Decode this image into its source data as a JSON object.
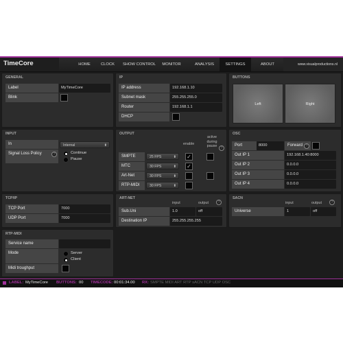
{
  "app": {
    "title": "TimeCore",
    "website": "www.visualproductions.nl",
    "accent_color": "#a0309a"
  },
  "nav": [
    {
      "label": "HOME",
      "active": false
    },
    {
      "label": "CLOCK",
      "active": false
    },
    {
      "label": "SHOW CONTROL",
      "active": false
    },
    {
      "label": "MONITOR",
      "active": false
    },
    {
      "label": "ANALYSIS",
      "active": false
    },
    {
      "label": "SETTINGS",
      "active": true
    },
    {
      "label": "ABOUT",
      "active": false
    }
  ],
  "general": {
    "title": "GENERAL",
    "label_label": "Label",
    "label_value": "MyTimeCore",
    "blink_label": "Blink",
    "blink_checked": false
  },
  "ip": {
    "title": "IP",
    "ip_label": "IP address",
    "ip_value": "192.168.1.10",
    "subnet_label": "Subnet mask",
    "subnet_value": "255.255.255.0",
    "router_label": "Router",
    "router_value": "192.168.1.1",
    "dhcp_label": "DHCP",
    "dhcp_checked": false
  },
  "buttons": {
    "title": "BUTTONS",
    "left": "Left",
    "right": "Right"
  },
  "input": {
    "title": "INPUT",
    "in_label": "In",
    "in_value": "Internal",
    "policy_label": "Signal Loss Policy",
    "help": "?",
    "options": [
      {
        "label": "Continue",
        "selected": true
      },
      {
        "label": "Pause",
        "selected": false
      }
    ]
  },
  "output": {
    "title": "OUTPUT",
    "enable_header": "enable",
    "active_header_1": "active",
    "active_header_2": "during",
    "active_header_3": "pause",
    "help": "?",
    "rows": [
      {
        "label": "SMPTE",
        "fps": "25 FPS",
        "enabled": true,
        "active_pause": false,
        "has_pause": true
      },
      {
        "label": "MTC",
        "fps": "30 FPS",
        "enabled": true,
        "active_pause": false,
        "has_pause": false
      },
      {
        "label": "Art-Net",
        "fps": "30 FPS",
        "enabled": false,
        "active_pause": false,
        "has_pause": true
      },
      {
        "label": "RTP-MIDI",
        "fps": "30 FPS",
        "enabled": false,
        "active_pause": false,
        "has_pause": false
      }
    ],
    "check_glyph": "✓"
  },
  "osc": {
    "title": "OSC",
    "port_label": "Port",
    "port_value": "8000",
    "forward_label": "Forward",
    "help": "?",
    "forward_checked": false,
    "outs": [
      {
        "label": "Out IP 1",
        "value": "192.168.1.40:8000"
      },
      {
        "label": "Out IP 2",
        "value": "0.0.0.0"
      },
      {
        "label": "Out IP 3",
        "value": "0.0.0.0"
      },
      {
        "label": "Out IP 4",
        "value": "0.0.0.0"
      }
    ]
  },
  "tcpip": {
    "title": "TCP/IP",
    "tcp_label": "TCP Port",
    "tcp_value": "7000",
    "udp_label": "UDP Port",
    "udp_value": "7000"
  },
  "artnet": {
    "title": "ART-NET",
    "input_header": "input",
    "output_header": "output",
    "help": "?",
    "subuni_label": "Sub.Uni",
    "subuni_input": "1.0",
    "subuni_output": "off",
    "dest_label": "Destination IP",
    "dest_value": "255.255.255.255"
  },
  "sacn": {
    "title": "SACN",
    "input_header": "input",
    "output_header": "output",
    "help": "?",
    "universe_label": "Universe",
    "universe_input": "1",
    "universe_output": "off"
  },
  "rtpmidi": {
    "title": "RTP-MIDI",
    "service_label": "Service name",
    "service_value": "",
    "mode_label": "Mode",
    "modes": [
      {
        "label": "Server",
        "selected": false
      },
      {
        "label": "Client",
        "selected": true
      }
    ],
    "through_label": "Midi troughput",
    "through_checked": false
  },
  "status": {
    "label_key": "LABEL:",
    "label_value": "MyTimeCore",
    "buttons_key": "BUTTONS:",
    "buttons_value": "00",
    "timecode_key": "TIMECODE:",
    "timecode_value": "00:01:34.00",
    "rx_key": "RX:",
    "rx_items": "SMPTE MIDI ART RTP sACN TCP UDP OSC"
  }
}
